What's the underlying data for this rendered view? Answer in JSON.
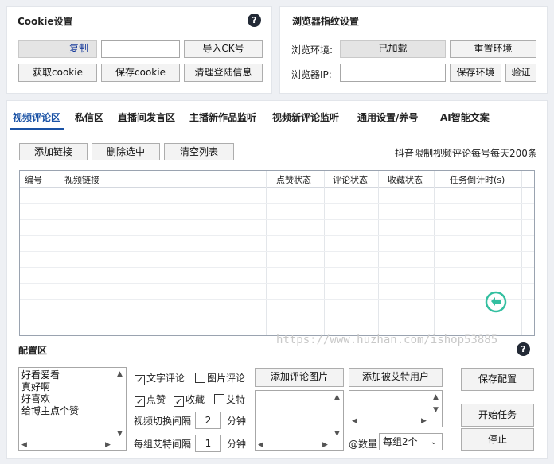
{
  "cookie_panel": {
    "title": "Cookie设置",
    "copy_label": "复制",
    "copy_input_value": "",
    "import_label": "导入CK号",
    "get_cookie_label": "获取cookie",
    "save_cookie_label": "保存cookie",
    "clear_login_label": "清理登陆信息"
  },
  "fingerprint_panel": {
    "title": "浏览器指纹设置",
    "env_label": "浏览环境:",
    "env_status": "已加载",
    "reset_env_label": "重置环境",
    "ip_label": "浏览器IP:",
    "ip_value": "",
    "save_env_label": "保存环境",
    "verify_label": "验证"
  },
  "tabs": [
    {
      "label": "视频评论区"
    },
    {
      "label": "私信区"
    },
    {
      "label": "直播间发言区"
    },
    {
      "label": "主播新作品监听"
    },
    {
      "label": "视频新评论监听"
    },
    {
      "label": "通用设置/养号"
    },
    {
      "label": "AI智能文案"
    }
  ],
  "toolbar": {
    "add_link_label": "添加链接",
    "delete_selected_label": "删除选中",
    "clear_list_label": "清空列表",
    "limit_note": "抖音限制视频评论每号每天200条"
  },
  "table": {
    "columns": [
      "编号",
      "视频链接",
      "点赞状态",
      "评论状态",
      "收藏状态",
      "任务倒计时(s)"
    ],
    "rows": []
  },
  "config": {
    "title": "配置区",
    "comments": [
      "好看爱看",
      "真好啊",
      "好喜欢",
      "给博主点个赞"
    ],
    "text_comment_label": "文字评论",
    "text_comment_checked": true,
    "image_comment_label": "图片评论",
    "image_comment_checked": false,
    "like_label": "点赞",
    "like_checked": true,
    "favorite_label": "收藏",
    "favorite_checked": true,
    "mention_label": "艾特",
    "mention_checked": false,
    "switch_interval_label": "视频切换间隔",
    "switch_interval_value": "2",
    "switch_interval_unit": "分钟",
    "mention_interval_label": "每组艾特间隔",
    "mention_interval_value": "1",
    "mention_interval_unit": "分钟",
    "add_comment_image_label": "添加评论图片",
    "add_mention_user_label": "添加被艾特用户",
    "count_label": "@数量",
    "count_value": "每组2个",
    "save_config_label": "保存配置",
    "start_task_label": "开始任务",
    "stop_label": "停止"
  },
  "watermark": "https://www.huzhan.com/ishop53885",
  "colors": {
    "accent": "#1a52a5",
    "refresh": "#33bfa0"
  }
}
